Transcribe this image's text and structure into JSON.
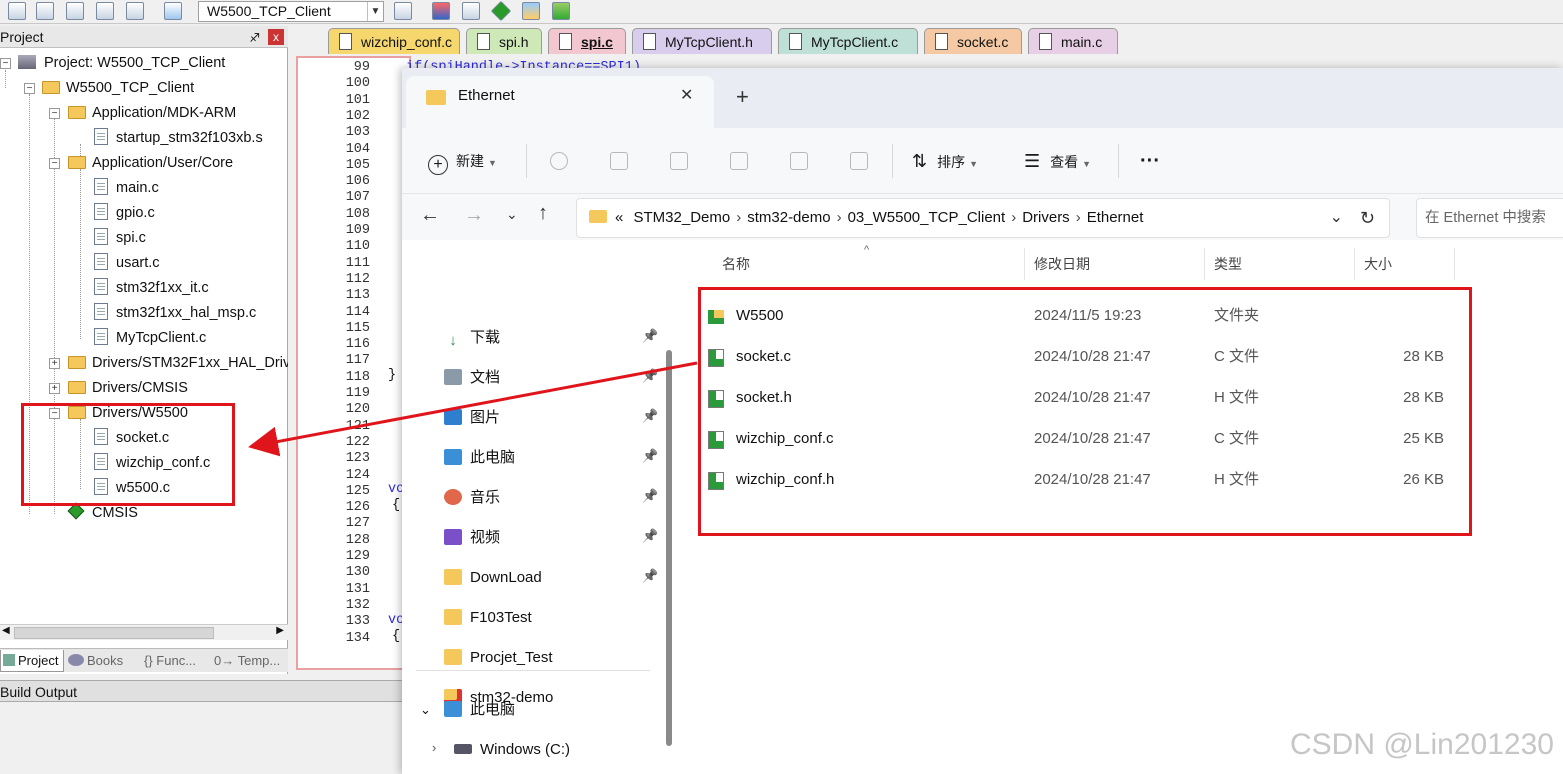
{
  "toolbar": {
    "target": "W5500_TCP_Client"
  },
  "project_panel": {
    "title": "Project",
    "pin": "♐",
    "close": "x",
    "tree": [
      {
        "label": "Project: W5500_TCP_Client"
      },
      {
        "label": "W5500_TCP_Client"
      },
      {
        "label": "Application/MDK-ARM"
      },
      {
        "label": "startup_stm32f103xb.s"
      },
      {
        "label": "Application/User/Core"
      },
      {
        "label": "main.c"
      },
      {
        "label": "gpio.c"
      },
      {
        "label": "spi.c"
      },
      {
        "label": "usart.c"
      },
      {
        "label": "stm32f1xx_it.c"
      },
      {
        "label": "stm32f1xx_hal_msp.c"
      },
      {
        "label": "MyTcpClient.c"
      },
      {
        "label": "Drivers/STM32F1xx_HAL_Driv"
      },
      {
        "label": "Drivers/CMSIS"
      },
      {
        "label": "Drivers/W5500"
      },
      {
        "label": "socket.c"
      },
      {
        "label": "wizchip_conf.c"
      },
      {
        "label": "w5500.c"
      },
      {
        "label": "CMSIS"
      }
    ],
    "bottom_tabs": [
      "Project",
      "Books",
      "{} Func...",
      "0→ Temp..."
    ]
  },
  "build_output": "Build Output",
  "editor": {
    "tabs": [
      {
        "label": "wizchip_conf.c",
        "color": "#f5d76e"
      },
      {
        "label": "spi.h",
        "color": "#cfe8b8"
      },
      {
        "label": "spi.c",
        "color": "#f2c7cf"
      },
      {
        "label": "MyTcpClient.h",
        "color": "#d9cdee"
      },
      {
        "label": "MyTcpClient.c",
        "color": "#bfe0d6"
      },
      {
        "label": "socket.c",
        "color": "#f5c9a3"
      },
      {
        "label": "main.c",
        "color": "#e7cfe6"
      }
    ],
    "line_numbers": [
      "99",
      "100",
      "101",
      "102",
      "103",
      "104",
      "105",
      "106",
      "107",
      "108",
      "109",
      "110",
      "111",
      "112",
      "113",
      "114",
      "115",
      "116",
      "117",
      "118",
      "119",
      "120",
      "121",
      "122",
      "123",
      "124",
      "125",
      "126",
      "127",
      "128",
      "129",
      "130",
      "131",
      "132",
      "133",
      "134"
    ],
    "code_top": "if(spiHandle->Instance==SPI1)",
    "code_close": "}",
    "code_vo": "vo",
    "code_brace": "{"
  },
  "explorer": {
    "tab_title": "Ethernet",
    "tab_close": "✕",
    "new_tab": "+",
    "toolbar": {
      "new_label": "新建",
      "sort_label": "排序",
      "view_label": "查看",
      "more": "···"
    },
    "address_prefix": "«",
    "breadcrumb": [
      "STM32_Demo",
      "stm32-demo",
      "03_W5500_TCP_Client",
      "Drivers",
      "Ethernet"
    ],
    "search_placeholder": "在 Ethernet 中搜索",
    "nav": [
      {
        "label": "下载",
        "pinned": true
      },
      {
        "label": "文档",
        "pinned": true
      },
      {
        "label": "图片",
        "pinned": true
      },
      {
        "label": "此电脑",
        "pinned": true
      },
      {
        "label": "音乐",
        "pinned": true
      },
      {
        "label": "视频",
        "pinned": true
      },
      {
        "label": "DownLoad",
        "pinned": true
      },
      {
        "label": "F103Test",
        "pinned": false
      },
      {
        "label": "Procjet_Test",
        "pinned": false
      },
      {
        "label": "stm32-demo",
        "pinned": false
      }
    ],
    "nav_bottom": [
      {
        "label": "此电脑"
      },
      {
        "label": "Windows (C:)"
      }
    ],
    "columns": [
      "名称",
      "修改日期",
      "类型",
      "大小"
    ],
    "files": [
      {
        "name": "W5500",
        "date": "2024/11/5 19:23",
        "type": "文件夹",
        "size": ""
      },
      {
        "name": "socket.c",
        "date": "2024/10/28 21:47",
        "type": "C 文件",
        "size": "28 KB"
      },
      {
        "name": "socket.h",
        "date": "2024/10/28 21:47",
        "type": "H 文件",
        "size": "28 KB"
      },
      {
        "name": "wizchip_conf.c",
        "date": "2024/10/28 21:47",
        "type": "C 文件",
        "size": "25 KB"
      },
      {
        "name": "wizchip_conf.h",
        "date": "2024/10/28 21:47",
        "type": "H 文件",
        "size": "26 KB"
      }
    ]
  },
  "watermark": "CSDN @Lin201230",
  "colors": {
    "highlight": "#e0141b",
    "arrow": "#e0141b",
    "folder": "#f5c85c"
  }
}
